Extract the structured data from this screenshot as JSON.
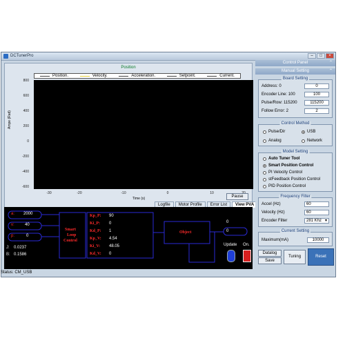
{
  "window": {
    "title": "DCTunerPro"
  },
  "plot": {
    "title": "Position",
    "legend": [
      "Position.",
      "Velocity.",
      "Acceleration.",
      "Setpoint.",
      "Current."
    ],
    "legend_colors": [
      "#444444",
      "#e8d23a",
      "#444444",
      "#444444",
      "#444444"
    ],
    "y_ticks": [
      "800",
      "600",
      "400",
      "200",
      "0",
      "-200",
      "-400",
      "-600"
    ],
    "x_ticks": [
      "-30",
      "-20",
      "-10",
      "0",
      "10",
      "20"
    ],
    "y_title": "Ampe (Rad)",
    "x_title": "Time (s)",
    "pause_label": "Pause"
  },
  "tabs": [
    {
      "label": "Logfile"
    },
    {
      "label": "Motor Profile"
    },
    {
      "label": "Error List"
    },
    {
      "label": "View PVA"
    }
  ],
  "diagram": {
    "inputs": [
      {
        "label": "a:",
        "value": "2000"
      },
      {
        "label": "v:",
        "value": "40"
      },
      {
        "label": "p:",
        "value": "0"
      }
    ],
    "j_label": "J:",
    "j_value": "0.0237",
    "b_label": "B:",
    "b_value": "0.1586",
    "controller": [
      "Smart",
      "Loop",
      "Control"
    ],
    "gains": [
      {
        "label": "Kp_P:",
        "value": "90"
      },
      {
        "label": "Ki_P:",
        "value": "0"
      },
      {
        "label": "Kd_P:",
        "value": "1"
      },
      {
        "label": "Kp_V:",
        "value": "4.54"
      },
      {
        "label": "Ki_V:",
        "value": "48.05"
      },
      {
        "label": "Kd_V:",
        "value": "0"
      }
    ],
    "object_label": "Object",
    "out_top": "0",
    "out_mid": "0",
    "update_label": "Update",
    "on_label": "On."
  },
  "right": {
    "control_panel": "Control Panel",
    "manual_setting": "Manual Setting",
    "board": {
      "title": "Board Setting",
      "rows": [
        {
          "label": "Address: 0",
          "value": "0"
        },
        {
          "label": "Encoder Line: 100",
          "value": "100"
        },
        {
          "label": "Pulse/Row: 115200",
          "value": "115200"
        },
        {
          "label": "Follow Error: 2",
          "value": "2"
        }
      ]
    },
    "method": {
      "title": "Control Method",
      "options": [
        "Pulse/Dir",
        "USB",
        "Analog",
        "Network"
      ]
    },
    "model": {
      "title": "Model Setting",
      "options": [
        "Auto Tuner Tool",
        "Smart Position Control",
        "PI Velocity Control",
        "stFeedback Position Control",
        "PID Position Control"
      ]
    },
    "freq": {
      "title": "Frequency Filter",
      "rows": [
        {
          "label": "Accel (Hz)",
          "value": "60"
        },
        {
          "label": "Velocity (Hz)",
          "value": "60"
        },
        {
          "label": "Encoder Filter",
          "value": "281 Khz"
        }
      ]
    },
    "current": {
      "title": "Current Setting",
      "label": "Maximum(mA)",
      "value": "10000"
    },
    "buttons": {
      "datalog": "Datalog",
      "save": "Save",
      "tuning": "Tuning",
      "reset": "Reset"
    }
  },
  "status": "Status:  CM_USB"
}
